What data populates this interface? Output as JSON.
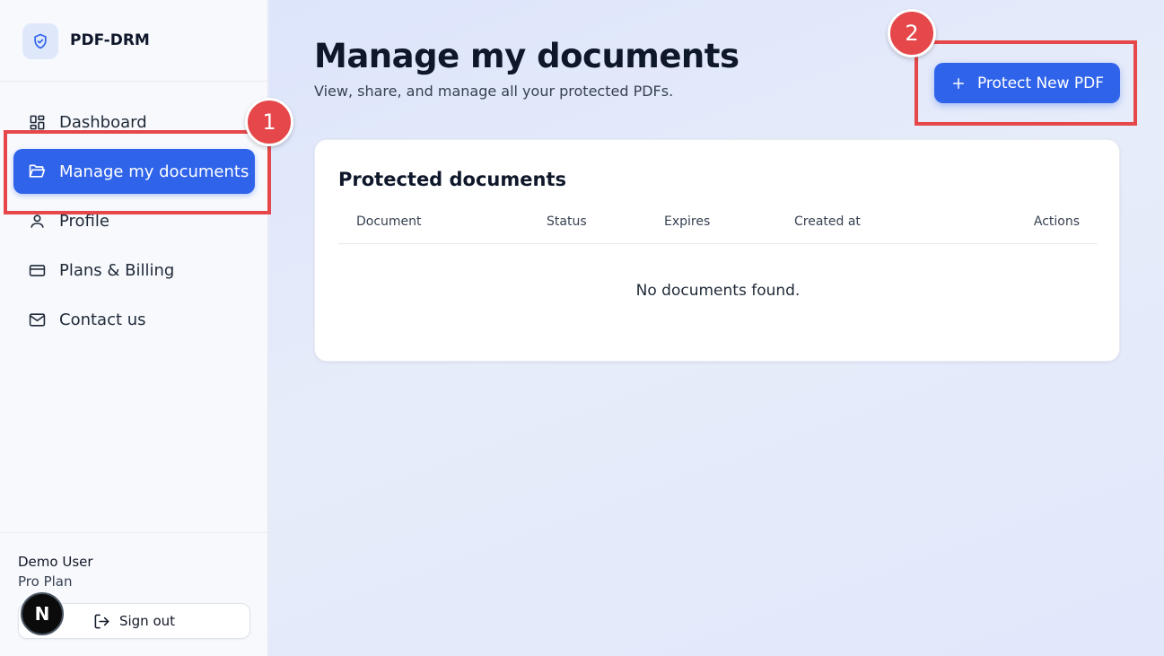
{
  "app": {
    "name": "PDF-DRM"
  },
  "sidebar": {
    "items": [
      {
        "label": "Dashboard",
        "icon": "dashboard-icon",
        "active": false
      },
      {
        "label": "Manage my documents",
        "icon": "folder-open-icon",
        "active": true
      },
      {
        "label": "Profile",
        "icon": "user-icon",
        "active": false
      },
      {
        "label": "Plans & Billing",
        "icon": "credit-card-icon",
        "active": false
      },
      {
        "label": "Contact us",
        "icon": "mail-icon",
        "active": false
      }
    ],
    "user": {
      "name": "Demo User",
      "plan": "Pro Plan"
    },
    "signout_label": "Sign out",
    "avatar_letter": "N"
  },
  "main": {
    "title": "Manage my documents",
    "subtitle": "View, share, and manage all your protected PDFs.",
    "primary_button": "Protect New PDF",
    "card": {
      "title": "Protected documents",
      "columns": [
        "Document",
        "Status",
        "Expires",
        "Created at",
        "Actions"
      ],
      "empty_message": "No documents found."
    }
  },
  "annotations": [
    {
      "number": "1",
      "target": "Manage my documents"
    },
    {
      "number": "2",
      "target": "Protect New PDF"
    }
  ],
  "colors": {
    "accent": "#2f63ea",
    "annotation": "#e5474a"
  }
}
